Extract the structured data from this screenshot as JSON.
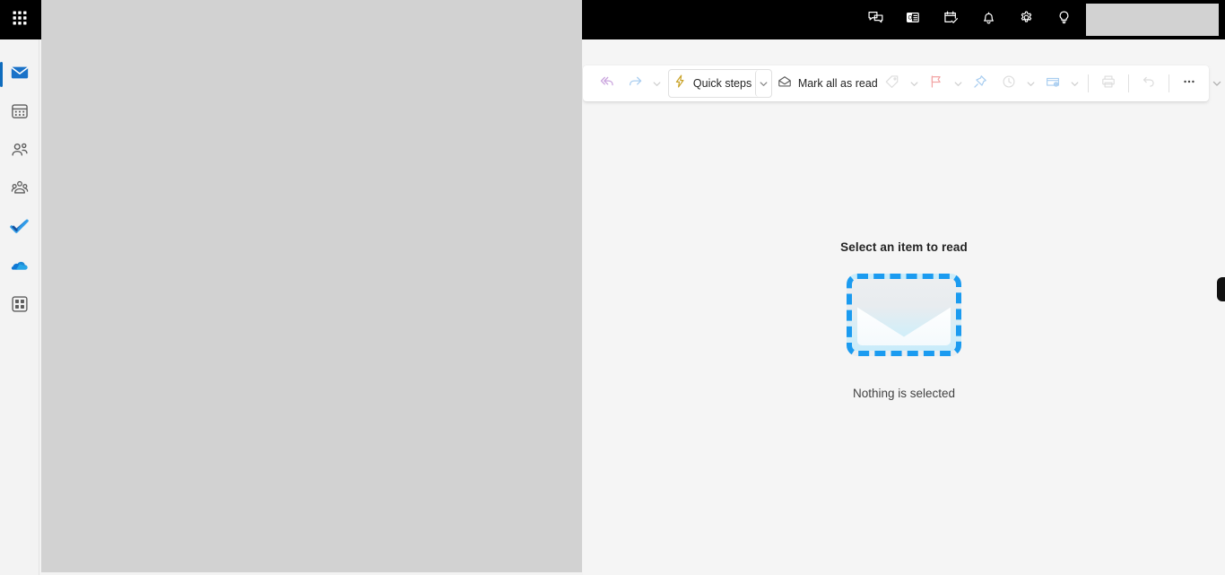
{
  "app": {
    "title": "Outlook Mail",
    "accent_color": "#0f6cbd",
    "header_bg": "#000000",
    "envelope_dash_color": "#1b9bf0"
  },
  "app_rail": {
    "launcher": {
      "name": "app-launcher",
      "icon": "waffle-grid-icon",
      "label": "App launcher"
    },
    "items": [
      {
        "name": "mail",
        "icon": "mail-icon",
        "label": "Mail",
        "selected": true
      },
      {
        "name": "calendar",
        "icon": "calendar-icon",
        "label": "Calendar",
        "selected": false
      },
      {
        "name": "people",
        "icon": "people-icon",
        "label": "People",
        "selected": false
      },
      {
        "name": "groups",
        "icon": "groups-icon",
        "label": "Groups",
        "selected": false
      },
      {
        "name": "to-do",
        "icon": "checkmark-icon",
        "label": "To Do",
        "selected": false
      },
      {
        "name": "onedrive",
        "icon": "cloud-icon",
        "label": "OneDrive",
        "selected": false
      },
      {
        "name": "more-apps",
        "icon": "apps-grid-icon",
        "label": "More apps",
        "selected": false
      }
    ]
  },
  "header": {
    "actions": [
      {
        "name": "teams-chat",
        "icon": "chat-bubbles-icon",
        "label": "Chat"
      },
      {
        "name": "outlook-card",
        "icon": "contact-card-icon",
        "label": "Outlook"
      },
      {
        "name": "my-day",
        "icon": "task-calendar-icon",
        "label": "My Day"
      },
      {
        "name": "notifications",
        "icon": "bell-icon",
        "label": "Notifications"
      },
      {
        "name": "settings",
        "icon": "gear-icon",
        "label": "Settings"
      },
      {
        "name": "tips",
        "icon": "lightbulb-icon",
        "label": "Tips"
      }
    ],
    "account_placeholder": {
      "name": "account-manager",
      "label": ""
    }
  },
  "command_bar": {
    "reply_all": {
      "label": "Reply all",
      "icon": "reply-all-icon"
    },
    "forward": {
      "label": "Forward",
      "icon": "forward-icon"
    },
    "forward_chevron": {
      "label": "More reply options",
      "icon": "chevron-down-icon"
    },
    "quick_steps": {
      "label": "Quick steps",
      "icon": "lightning-bolt-icon"
    },
    "quick_steps_chevron": {
      "label": "Quick steps options",
      "icon": "chevron-down-icon"
    },
    "mark_all_read": {
      "label": "Mark all as read",
      "icon": "open-envelope-icon"
    },
    "tag": {
      "label": "Tag",
      "icon": "tag-icon"
    },
    "tag_chevron": {
      "label": "Tag options",
      "icon": "chevron-down-icon"
    },
    "flag": {
      "label": "Flag",
      "icon": "flag-icon"
    },
    "flag_chevron": {
      "label": "Flag options",
      "icon": "chevron-down-icon"
    },
    "pin": {
      "label": "Pin",
      "icon": "pin-icon"
    },
    "snooze": {
      "label": "Snooze",
      "icon": "clock-icon"
    },
    "snooze_chevron": {
      "label": "Snooze options",
      "icon": "chevron-down-icon"
    },
    "move_to": {
      "label": "Move to",
      "icon": "move-to-folder-icon"
    },
    "move_to_chevron": {
      "label": "Move to options",
      "icon": "chevron-down-icon"
    },
    "print": {
      "label": "Print",
      "icon": "printer-icon"
    },
    "undo": {
      "label": "Undo",
      "icon": "undo-arrow-icon"
    },
    "more": {
      "label": "More options",
      "icon": "ellipsis-icon"
    },
    "overflow_chevron": {
      "label": "Show more commands",
      "icon": "chevron-down-icon"
    }
  },
  "reading_pane": {
    "empty_title": "Select an item to read",
    "empty_subtitle": "Nothing is selected",
    "illustration": "empty-envelope-illustration"
  },
  "panel_handle": {
    "label": "Collapse pane",
    "name": "panel-collapse-handle"
  }
}
